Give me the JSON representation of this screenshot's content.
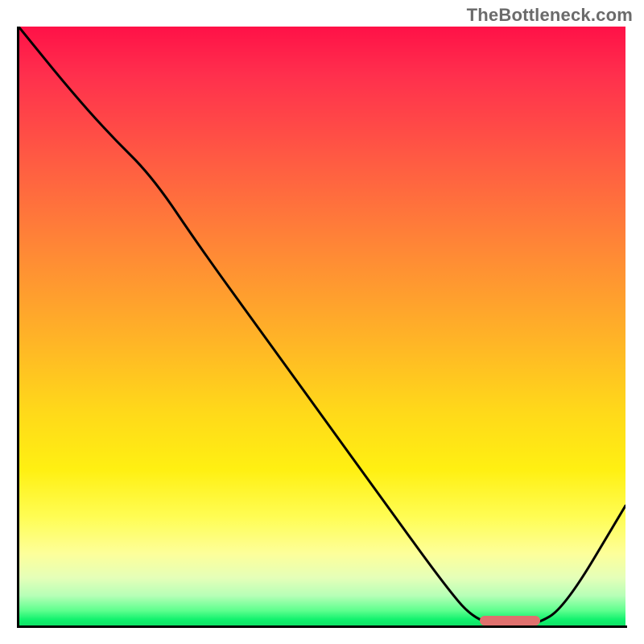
{
  "watermark": "TheBottleneck.com",
  "colors": {
    "gradient_top": "#ff1147",
    "gradient_mid": "#ffd81a",
    "gradient_bottom": "#0ee366",
    "curve": "#000000",
    "axis": "#000000",
    "marker": "#e0716e"
  },
  "chart_data": {
    "type": "line",
    "title": "",
    "xlabel": "",
    "ylabel": "",
    "xlim": [
      0,
      100
    ],
    "ylim": [
      0,
      100
    ],
    "grid": false,
    "x": [
      0,
      8,
      15,
      22,
      30,
      40,
      50,
      60,
      70,
      75,
      80,
      85,
      90,
      100
    ],
    "values": [
      100,
      90,
      82,
      75,
      63,
      49,
      35,
      21,
      7,
      1,
      0,
      0,
      3,
      20
    ],
    "marker_segment": {
      "x_start": 76,
      "x_end": 86,
      "y": 0.8
    },
    "notes": "Vertical gradient from red (top, high) to green (bottom, low) with a black curve descending from top-left to a minimum near x≈80 then rising toward bottom-right."
  }
}
